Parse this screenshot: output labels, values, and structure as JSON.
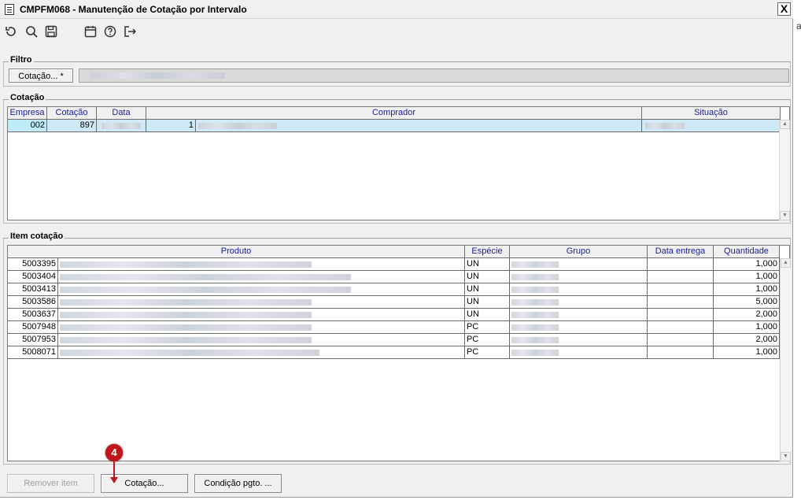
{
  "window": {
    "title": "CMPFM068 - Manutenção de Cotação por Intervalo",
    "close_label": "X"
  },
  "toolbar": {
    "icons": [
      "refresh-icon",
      "search-icon",
      "save-icon",
      "calendar-icon",
      "help-icon",
      "exit-icon"
    ]
  },
  "filtro": {
    "label": "Filtro",
    "button_label": "Cotação... *"
  },
  "cotacao": {
    "label": "Cotação",
    "columns": [
      "Empresa",
      "Cotação",
      "Data",
      "Comprador",
      "Situação"
    ],
    "rows": [
      {
        "empresa": "002",
        "cotacao": "897",
        "comprador_code": "1"
      }
    ]
  },
  "item_cotacao": {
    "label": "Item cotação",
    "columns": [
      "Produto",
      "Espécie",
      "Grupo",
      "Data entrega",
      "Quantidade"
    ],
    "rows": [
      {
        "produto": "5003395",
        "especie": "UN",
        "quantidade": "1,000"
      },
      {
        "produto": "5003404",
        "especie": "UN",
        "quantidade": "1,000"
      },
      {
        "produto": "5003413",
        "especie": "UN",
        "quantidade": "1,000"
      },
      {
        "produto": "5003586",
        "especie": "UN",
        "quantidade": "5,000"
      },
      {
        "produto": "5003637",
        "especie": "UN",
        "quantidade": "2,000"
      },
      {
        "produto": "5007948",
        "especie": "PC",
        "quantidade": "1,000"
      },
      {
        "produto": "5007953",
        "especie": "PC",
        "quantidade": "2,000"
      },
      {
        "produto": "5008071",
        "especie": "PC",
        "quantidade": "1,000"
      }
    ]
  },
  "buttons": {
    "remover_item": "Remover item",
    "cotacao": "Cotação...",
    "condicao_pgto": "Condição pgto. ..."
  },
  "annotation": {
    "step_number": "4"
  },
  "edge_glyph": "a",
  "colors": {
    "selected_row": "#cfe9f7",
    "header_text": "#1a1aa0",
    "badge": "#c0161b"
  }
}
